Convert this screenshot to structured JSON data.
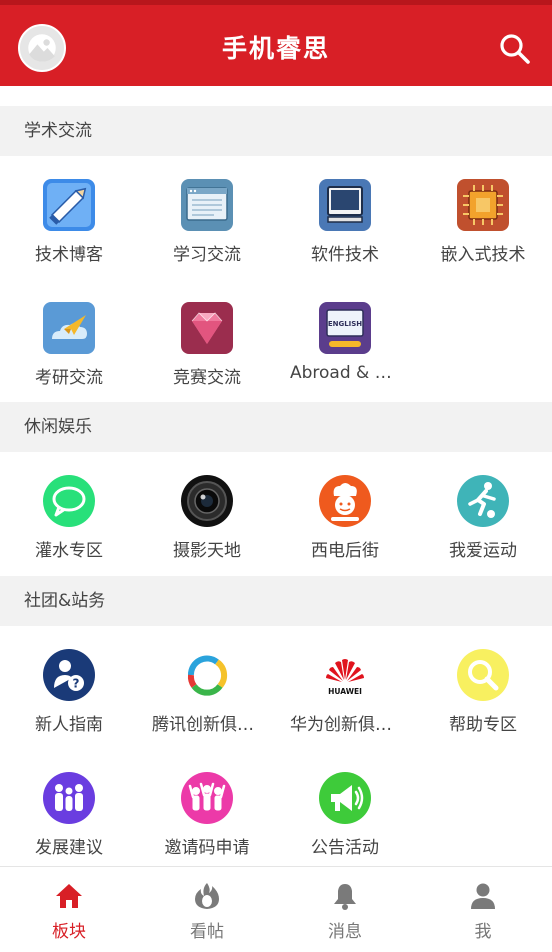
{
  "header": {
    "title": "手机睿思",
    "avatar_icon": "avatar-placeholder-icon",
    "search_icon": "search-icon",
    "bg_color": "#d81f26"
  },
  "sections": [
    {
      "title": "学术交流",
      "items": [
        {
          "label": "技术博客",
          "icon": "pencil-icon",
          "color": "#3d8be8"
        },
        {
          "label": "学习交流",
          "icon": "browser-window-icon",
          "color": "#5b90b4"
        },
        {
          "label": "软件技术",
          "icon": "monitor-icon",
          "color": "#4a78b5"
        },
        {
          "label": "嵌入式技术",
          "icon": "chip-icon",
          "color": "#c0502e"
        },
        {
          "label": "考研交流",
          "icon": "paper-plane-cloud-icon",
          "color": "#5a9ad6"
        },
        {
          "label": "竞赛交流",
          "icon": "diamond-icon",
          "color": "#9b2d4e"
        },
        {
          "label": "Abroad & Exchange",
          "icon": "english-board-icon",
          "color": "#5b3d8c"
        }
      ]
    },
    {
      "title": "休闲娱乐",
      "items": [
        {
          "label": "灌水专区",
          "icon": "chat-bubble-icon",
          "color": "#28e07a"
        },
        {
          "label": "摄影天地",
          "icon": "camera-lens-icon",
          "color": "#111111"
        },
        {
          "label": "西电后街",
          "icon": "chef-icon",
          "color": "#ef5a1e"
        },
        {
          "label": "我爱运动",
          "icon": "soccer-player-icon",
          "color": "#3fb4b8"
        }
      ]
    },
    {
      "title": "社团&站务",
      "items": [
        {
          "label": "新人指南",
          "icon": "user-help-icon",
          "color": "#1a3a78"
        },
        {
          "label": "腾讯创新俱乐部",
          "icon": "tencent-logo-icon",
          "color": "#2aa3dc"
        },
        {
          "label": "华为创新俱乐部",
          "icon": "huawei-logo-icon",
          "color": "#e0141e"
        },
        {
          "label": "帮助专区",
          "icon": "magnifier-help-icon",
          "color": "#f8f060"
        },
        {
          "label": "发展建议",
          "icon": "people-group-icon",
          "color": "#6a3de0"
        },
        {
          "label": "邀请码申请",
          "icon": "people-cheer-icon",
          "color": "#ec3aa8"
        },
        {
          "label": "公告活动",
          "icon": "megaphone-icon",
          "color": "#3ecb3a"
        }
      ]
    }
  ],
  "bottom_nav": [
    {
      "label": "板块",
      "icon": "home-icon",
      "active": true
    },
    {
      "label": "看帖",
      "icon": "flame-icon",
      "active": false
    },
    {
      "label": "消息",
      "icon": "bell-icon",
      "active": false
    },
    {
      "label": "我",
      "icon": "person-icon",
      "active": false
    }
  ]
}
